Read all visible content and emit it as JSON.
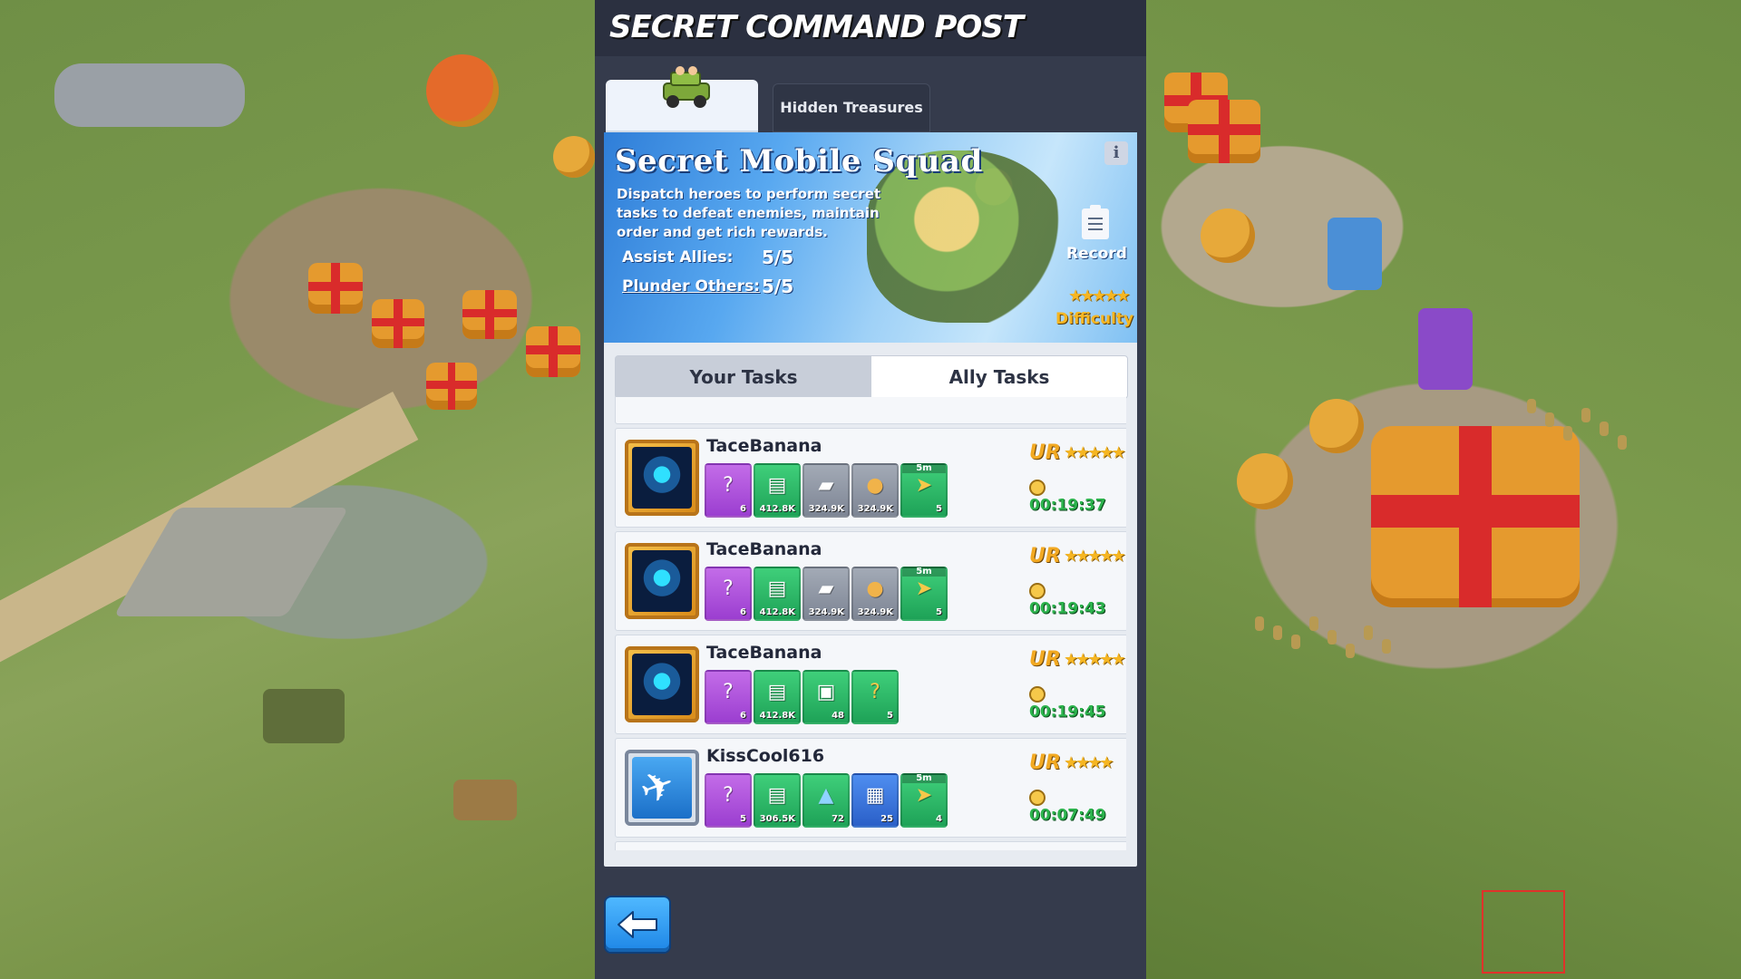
{
  "panel": {
    "title": "SECRET COMMAND POST",
    "tabs": [
      {
        "label": "",
        "icon": "jeep-icon",
        "active": true
      },
      {
        "label": "Hidden Treasures",
        "active": false
      }
    ]
  },
  "banner": {
    "title": "Secret Mobile Squad",
    "description": "Dispatch heroes to perform secret tasks to defeat enemies, maintain order and get rich rewards.",
    "stats": [
      {
        "label": "Assist Allies:",
        "value": "5/5"
      },
      {
        "label": "Plunder Others:",
        "value": "5/5"
      }
    ],
    "record_label": "Record",
    "difficulty_label": "Difficulty",
    "difficulty_stars": "★★★★★"
  },
  "task_tabs": {
    "left": "Your Tasks",
    "right": "Ally Tasks",
    "active": "right"
  },
  "tasks": [
    {
      "player": "TaceBanana",
      "avatar": "hero",
      "rank": "UR",
      "stars": "★★★★★",
      "timer": "00:19:37",
      "rewards": [
        {
          "type": "mystery-box",
          "qty": "6",
          "color": "purple",
          "glyph": "?"
        },
        {
          "type": "paper-stack",
          "qty": "412.8K",
          "color": "green",
          "glyph": "▤"
        },
        {
          "type": "steel-ingot",
          "qty": "324.9K",
          "color": "gray",
          "glyph": "▰"
        },
        {
          "type": "bread",
          "qty": "324.9K",
          "color": "gray",
          "glyph": "●"
        },
        {
          "type": "speedup",
          "qty": "5",
          "color": "green",
          "glyph": "➤",
          "tag": "5m"
        }
      ]
    },
    {
      "player": "TaceBanana",
      "avatar": "hero",
      "rank": "UR",
      "stars": "★★★★★",
      "timer": "00:19:43",
      "rewards": [
        {
          "type": "mystery-box",
          "qty": "6",
          "color": "purple",
          "glyph": "?"
        },
        {
          "type": "paper-stack",
          "qty": "412.8K",
          "color": "green",
          "glyph": "▤"
        },
        {
          "type": "steel-ingot",
          "qty": "324.9K",
          "color": "gray",
          "glyph": "▰"
        },
        {
          "type": "bread",
          "qty": "324.9K",
          "color": "gray",
          "glyph": "●"
        },
        {
          "type": "speedup",
          "qty": "5",
          "color": "green",
          "glyph": "➤",
          "tag": "5m"
        }
      ]
    },
    {
      "player": "TaceBanana",
      "avatar": "hero",
      "rank": "UR",
      "stars": "★★★★★",
      "timer": "00:19:45",
      "rewards": [
        {
          "type": "mystery-box",
          "qty": "6",
          "color": "purple",
          "glyph": "?"
        },
        {
          "type": "paper-stack",
          "qty": "412.8K",
          "color": "green",
          "glyph": "▤"
        },
        {
          "type": "supply-crate",
          "qty": "48",
          "color": "green",
          "glyph": "▣"
        },
        {
          "type": "gold-box",
          "qty": "5",
          "color": "green",
          "glyph": "?"
        }
      ]
    },
    {
      "player": "KissCool616",
      "avatar": "plane",
      "rank": "UR",
      "stars": "★★★★",
      "timer": "00:07:49",
      "rewards": [
        {
          "type": "mystery-box",
          "qty": "5",
          "color": "purple",
          "glyph": "?"
        },
        {
          "type": "paper-stack",
          "qty": "306.5K",
          "color": "green",
          "glyph": "▤"
        },
        {
          "type": "crystal",
          "qty": "72",
          "color": "green",
          "glyph": "▲"
        },
        {
          "type": "treasure-chest",
          "qty": "25",
          "color": "blue",
          "glyph": "▦"
        },
        {
          "type": "speedup",
          "qty": "4",
          "color": "green",
          "glyph": "➤",
          "tag": "5m"
        }
      ]
    }
  ],
  "back_button": {
    "icon": "back-arrow-icon"
  },
  "colors": {
    "panel_bg": "#353b4c",
    "timer_green": "#2bb24c",
    "rank_gold": "#f2a922",
    "back_blue": "#1e86e6"
  }
}
